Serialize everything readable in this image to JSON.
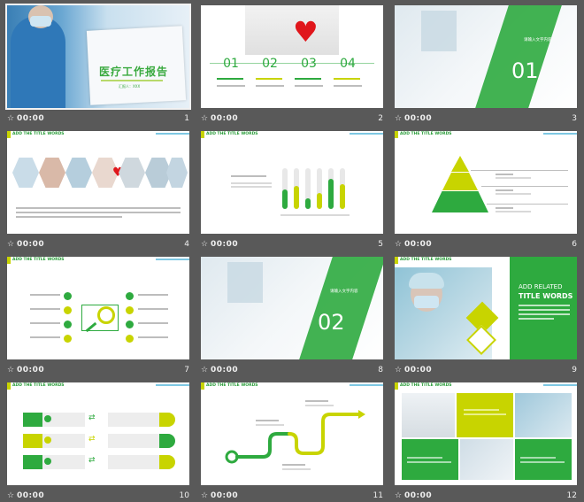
{
  "slides": [
    {
      "num": "1",
      "time": "00:00",
      "title_cn": "医疗工作报告",
      "subtitle": "汇报人：XXX"
    },
    {
      "num": "2",
      "time": "00:00",
      "items": [
        "01",
        "02",
        "03",
        "04"
      ]
    },
    {
      "num": "3",
      "time": "00:00",
      "big": "01",
      "label": "请输入文字内容"
    },
    {
      "num": "4",
      "time": "00:00",
      "header": "ADD THE TITLE WORDS"
    },
    {
      "num": "5",
      "time": "00:00",
      "header": "ADD THE TITLE WORDS"
    },
    {
      "num": "6",
      "time": "00:00",
      "header": "ADD THE TITLE WORDS"
    },
    {
      "num": "7",
      "time": "00:00",
      "header": "ADD THE TITLE WORDS"
    },
    {
      "num": "8",
      "time": "00:00",
      "big": "02",
      "label": "请输入文字内容"
    },
    {
      "num": "9",
      "time": "00:00",
      "header": "ADD THE TITLE WORDS",
      "title_line1": "ADD RELATED",
      "title_line2": "TITLE WORDS"
    },
    {
      "num": "10",
      "time": "00:00",
      "header": "ADD THE TITLE WORDS"
    },
    {
      "num": "11",
      "time": "00:00",
      "header": "ADD THE TITLE WORDS"
    },
    {
      "num": "12",
      "time": "00:00",
      "header": "ADD THE TITLE WORDS"
    }
  ],
  "icons": {
    "star": "star-icon"
  },
  "colors": {
    "green": "#2eaa3f",
    "yellow": "#c8d400",
    "bg": "#595959"
  }
}
